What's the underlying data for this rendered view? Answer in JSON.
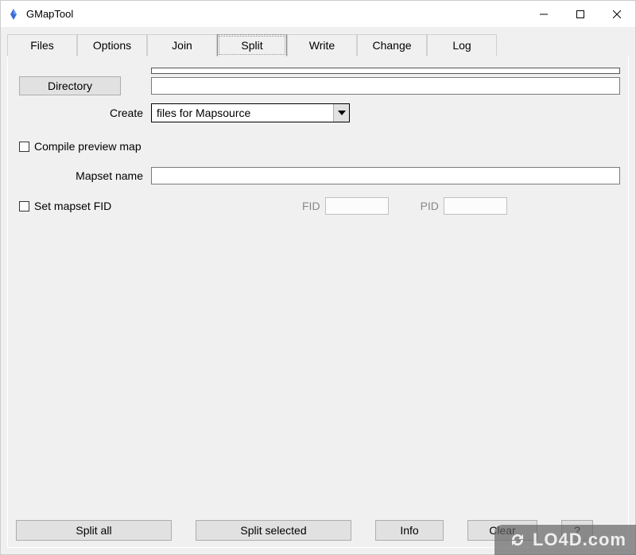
{
  "window": {
    "title": "GMapTool"
  },
  "tabs": [
    "Files",
    "Options",
    "Join",
    "Split",
    "Write",
    "Change",
    "Log"
  ],
  "active_tab_index": 3,
  "form": {
    "directory_button": "Directory",
    "directory_value": "",
    "create_label": "Create",
    "create_value": "files for Mapsource",
    "compile_preview_label": "Compile preview map",
    "compile_preview_checked": false,
    "mapset_name_label": "Mapset name",
    "mapset_name_value": "",
    "set_mapset_fid_label": "Set mapset FID",
    "set_mapset_fid_checked": false,
    "fid_label": "FID",
    "fid_value": "",
    "pid_label": "PID",
    "pid_value": ""
  },
  "buttons": {
    "split_all": "Split all",
    "split_selected": "Split selected",
    "info": "Info",
    "clear": "Clear",
    "help": "?"
  },
  "watermark": "LO4D.com"
}
